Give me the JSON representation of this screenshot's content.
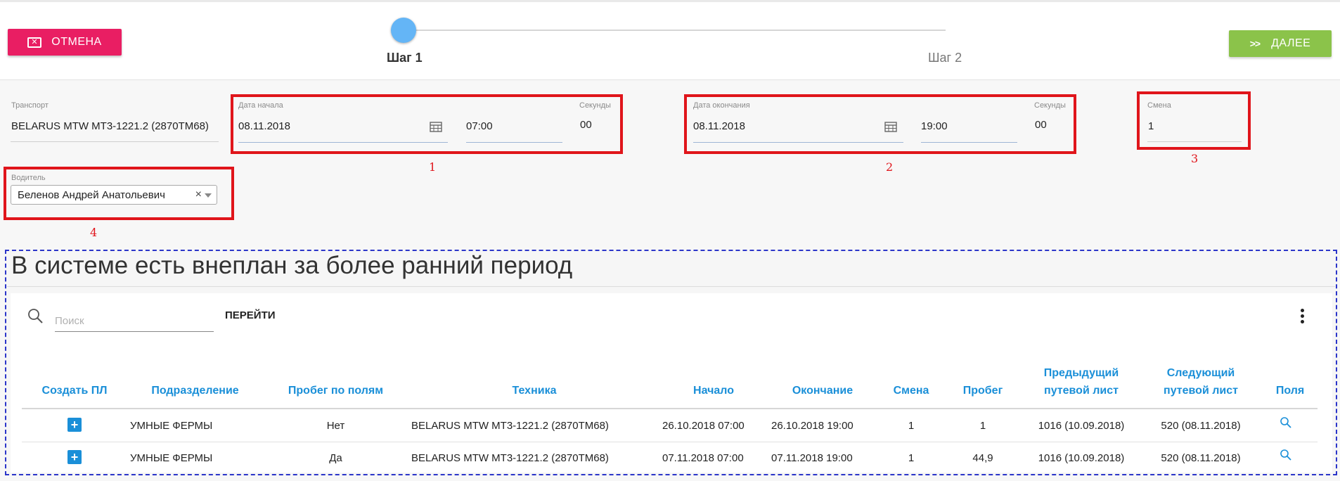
{
  "header": {
    "cancel_label": "ОТМЕНА",
    "next_label": "ДАЛЕЕ",
    "steps": [
      {
        "label": "Шаг 1",
        "active": true
      },
      {
        "label": "Шаг 2",
        "active": false
      }
    ]
  },
  "form": {
    "transport": {
      "label": "Транспорт",
      "value": "BELARUS MTW MT3-1221.2 (2870TM68)"
    },
    "start": {
      "label": "Дата начала",
      "date": "08.11.2018",
      "time": "07:00",
      "seconds_label": "Секунды",
      "seconds": "00"
    },
    "end": {
      "label": "Дата окончания",
      "date": "08.11.2018",
      "time": "19:00",
      "seconds_label": "Секунды",
      "seconds": "00"
    },
    "shift": {
      "label": "Смена",
      "value": "1"
    },
    "driver": {
      "label": "Водитель",
      "value": "Беленов Андрей Анатольевич",
      "clear": "×"
    }
  },
  "annotations": {
    "n1": "1",
    "n2": "2",
    "n3": "3",
    "n4": "4"
  },
  "panel": {
    "title": "В системе есть внеплан за более ранний период",
    "search_placeholder": "Поиск",
    "goto_label": "ПЕРЕЙТИ",
    "columns": {
      "create": "Создать ПЛ",
      "division": "Подразделение",
      "mileage_fields": "Пробег по полям",
      "vehicle": "Техника",
      "start": "Начало",
      "end": "Окончание",
      "shift": "Смена",
      "mileage": "Пробег",
      "prev_line1": "Предыдущий",
      "prev_line2": "путевой лист",
      "next_line1": "Следующий",
      "next_line2": "путевой лист",
      "fields": "Поля"
    },
    "rows": [
      {
        "division": "УМНЫЕ ФЕРМЫ",
        "mileage_fields": "Нет",
        "vehicle": "BELARUS MTW MT3-1221.2 (2870TM68)",
        "start": "26.10.2018 07:00",
        "end": "26.10.2018 19:00",
        "shift": "1",
        "mileage": "1",
        "prev": "1016 (10.09.2018)",
        "next": "520 (08.11.2018)"
      },
      {
        "division": "УМНЫЕ ФЕРМЫ",
        "mileage_fields": "Да",
        "vehicle": "BELARUS MTW MT3-1221.2 (2870TM68)",
        "start": "07.11.2018 07:00",
        "end": "07.11.2018 19:00",
        "shift": "1",
        "mileage": "44,9",
        "prev": "1016 (10.09.2018)",
        "next": "520 (08.11.2018)"
      }
    ]
  },
  "colors": {
    "cancel": "#e91e63",
    "next": "#8bc34a",
    "step_active": "#64b5f6",
    "accent": "#1a8fd8",
    "annotation_red": "#e0151b",
    "annotation_blue": "#2b35c9"
  }
}
